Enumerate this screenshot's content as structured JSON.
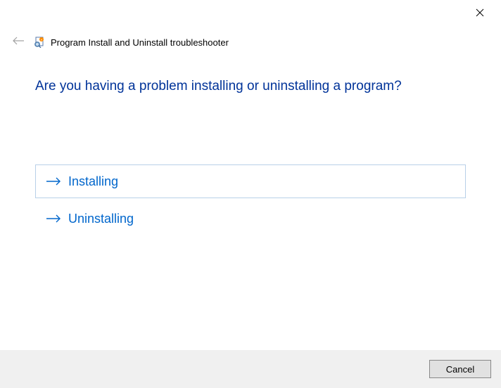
{
  "window": {
    "title": "Program Install and Uninstall troubleshooter"
  },
  "main": {
    "heading": "Are you having a problem installing or uninstalling a program?",
    "options": [
      {
        "label": "Installing",
        "selected": true
      },
      {
        "label": "Uninstalling",
        "selected": false
      }
    ]
  },
  "footer": {
    "cancel_label": "Cancel"
  }
}
